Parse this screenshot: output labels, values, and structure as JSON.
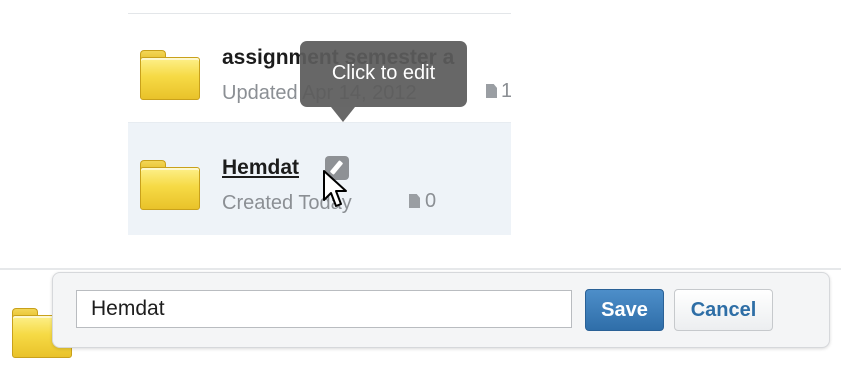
{
  "folders": [
    {
      "name": "assignment semester a",
      "meta": "Updated Apr 14, 2012",
      "count": "1",
      "icon": "folder-icon"
    },
    {
      "name": "Hemdat",
      "meta": "Created Today",
      "count": "0",
      "icon": "folder-icon"
    }
  ],
  "tooltip": {
    "text": "Click to edit"
  },
  "rename": {
    "value": "Hemdat",
    "save_label": "Save",
    "cancel_label": "Cancel"
  },
  "colors": {
    "tooltip_bg": "#5c5c5c",
    "selected_row_bg": "#eef3f8",
    "save_button": "#3b7dbb",
    "cancel_text": "#2e6ea6",
    "folder_yellow": "#f6da45"
  }
}
